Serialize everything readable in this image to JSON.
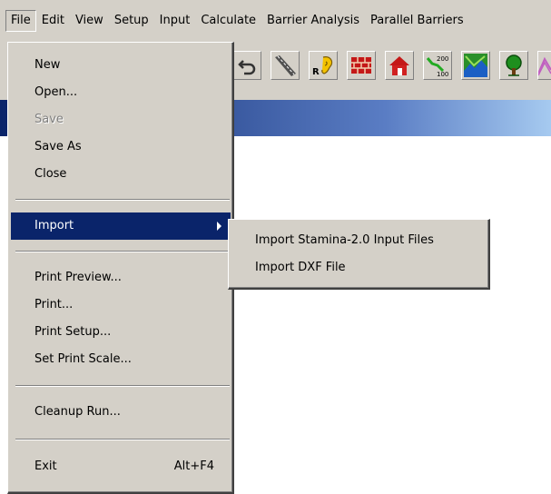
{
  "menubar": {
    "items": [
      "File",
      "Edit",
      "View",
      "Setup",
      "Input",
      "Calculate",
      "Barrier Analysis",
      "Parallel Barriers"
    ]
  },
  "toolbar": {
    "icons": [
      "undo-icon",
      "road-icon",
      "receiver-icon",
      "barrier-icon",
      "building-icon",
      "contour-icon",
      "terrain-icon",
      "tree-zone-icon",
      "ground-zone-icon"
    ],
    "contour_labels": [
      "200",
      "100"
    ],
    "receiver_label": "R"
  },
  "file_menu": {
    "new": "New",
    "open": "Open...",
    "save": "Save",
    "save_as": "Save As",
    "close": "Close",
    "import": "Import",
    "print_preview": "Print Preview...",
    "print": "Print...",
    "print_setup": "Print Setup...",
    "set_print_scale": "Set Print Scale...",
    "cleanup_run": "Cleanup Run...",
    "exit": "Exit",
    "exit_shortcut": "Alt+F4"
  },
  "import_submenu": {
    "stamina": "Import Stamina-2.0 Input Files",
    "dxf": "Import DXF File"
  },
  "colors": {
    "menu_bg": "#d4d0c8",
    "highlight": "#0a246a",
    "title_gradient_start": "#0a246a",
    "title_gradient_end": "#a6caf0"
  }
}
